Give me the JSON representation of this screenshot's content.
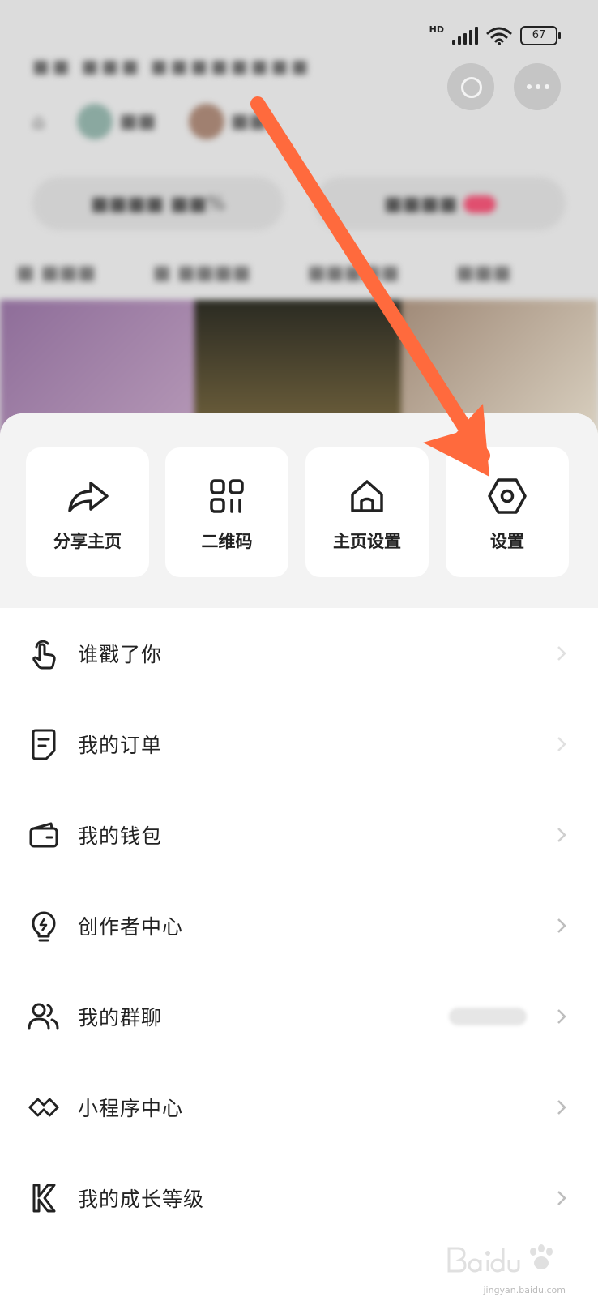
{
  "status_bar": {
    "time": "",
    "network": "HD",
    "battery": "67"
  },
  "quick_actions": [
    {
      "label": "分享主页",
      "icon": "share-icon"
    },
    {
      "label": "二维码",
      "icon": "qr-code-icon"
    },
    {
      "label": "主页设置",
      "icon": "home-icon"
    },
    {
      "label": "设置",
      "icon": "settings-hexagon-icon"
    }
  ],
  "menu": [
    {
      "label": "谁戳了你",
      "icon": "tap-finger-icon"
    },
    {
      "label": "我的订单",
      "icon": "order-doc-icon"
    },
    {
      "label": "我的钱包",
      "icon": "wallet-icon"
    },
    {
      "label": "创作者中心",
      "icon": "bulb-icon"
    },
    {
      "label": "我的群聊",
      "icon": "group-users-icon"
    },
    {
      "label": "小程序中心",
      "icon": "mini-program-icon"
    },
    {
      "label": "我的成长等级",
      "icon": "growth-k-icon"
    }
  ],
  "colors": {
    "arrow": "#ff6a3d",
    "sheet": "#ffffff",
    "quick_bar": "#f3f3f3"
  },
  "watermark": {
    "text": "jingyan.baidu.com"
  }
}
